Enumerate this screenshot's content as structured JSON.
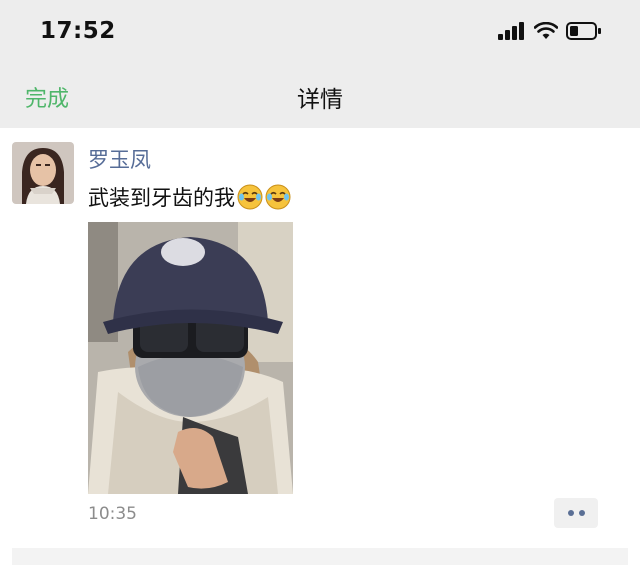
{
  "status_bar": {
    "time": "17:52"
  },
  "nav": {
    "done_label": "完成",
    "title": "详情"
  },
  "post": {
    "username": "罗玉凤",
    "text": "武装到牙齿的我",
    "emoji": [
      "laugh-cry-emoji",
      "laugh-cry-emoji"
    ],
    "time": "10:35"
  },
  "colors": {
    "accent_green": "#4fb66a",
    "name_blue": "#566c97",
    "bar_gray": "#ededed"
  }
}
